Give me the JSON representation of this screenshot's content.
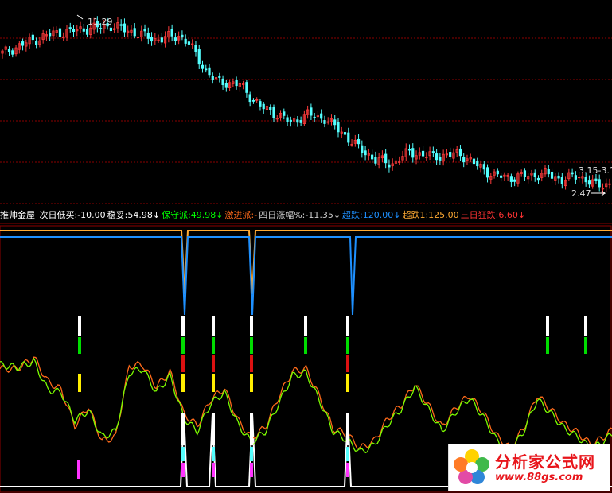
{
  "colors": {
    "bg": "#000000",
    "grid": "#8b0000",
    "up": "#ff3b3b",
    "down": "#54ffff",
    "orange_line": "#ff6a1a",
    "green_line": "#7cfc00",
    "lime_line": "#c8ff00",
    "gold": "#ffaa33",
    "blue": "#1e90ff",
    "magenta": "#ff33ff",
    "white": "#ffffff",
    "axis_text": "#dddddd"
  },
  "top_panel": {
    "annotations": {
      "high": "11.29",
      "right": "3.15-3.1",
      "low": "2.47"
    }
  },
  "info_bar": {
    "title": "推帅金屋",
    "items": [
      {
        "label": "次日低买:",
        "value": "-10.00",
        "color": "#ffffff"
      },
      {
        "label": "稳妥:",
        "value": "54.98",
        "color": "#ffffff",
        "arrow": "↓"
      },
      {
        "label": "保守派:",
        "value": "49.98",
        "color": "#00ff00",
        "arrow": "↓"
      },
      {
        "label": "激进派:",
        "value": "-",
        "color": "#ff6a1a"
      },
      {
        "label": "四日涨幅%:",
        "value": "-11.35",
        "color": "#cccccc",
        "arrow": "↓"
      },
      {
        "label": "超跌:",
        "value": "120.00",
        "color": "#1e90ff",
        "arrow": "↓"
      },
      {
        "label": "超跌1:",
        "value": "125.00",
        "color": "#ffaa33"
      },
      {
        "label": "三日狂跌:",
        "value": "6.60",
        "color": "#ff3333",
        "arrow": "↓"
      }
    ]
  },
  "watermark": {
    "title": "分析家公式网",
    "url": "www.88gs.com"
  },
  "chart_data": [
    {
      "type": "candlestick",
      "title": "",
      "n_bars": 180,
      "y_range": [
        2.0,
        12.0
      ],
      "high_marker": 11.29,
      "low_marker": 2.47,
      "close_path": [
        [
          0,
          9.7
        ],
        [
          8,
          10.3
        ],
        [
          15,
          10.7
        ],
        [
          23,
          10.9
        ],
        [
          28,
          11.0
        ],
        [
          32,
          11.1
        ],
        [
          40,
          10.7
        ],
        [
          45,
          10.4
        ],
        [
          52,
          10.6
        ],
        [
          55,
          10.2
        ],
        [
          60,
          8.8
        ],
        [
          63,
          8.3
        ],
        [
          70,
          8.1
        ],
        [
          76,
          7.0
        ],
        [
          80,
          6.7
        ],
        [
          85,
          6.2
        ],
        [
          90,
          6.6
        ],
        [
          95,
          6.4
        ],
        [
          100,
          5.7
        ],
        [
          105,
          4.9
        ],
        [
          110,
          4.3
        ],
        [
          115,
          4.1
        ],
        [
          120,
          4.7
        ],
        [
          125,
          4.5
        ],
        [
          130,
          4.5
        ],
        [
          135,
          4.6
        ],
        [
          140,
          4.0
        ],
        [
          145,
          3.5
        ],
        [
          150,
          3.4
        ],
        [
          155,
          3.5
        ],
        [
          160,
          3.6
        ],
        [
          165,
          3.3
        ],
        [
          170,
          3.5
        ],
        [
          175,
          3.0
        ],
        [
          180,
          3.1
        ]
      ]
    },
    {
      "type": "line",
      "title": "",
      "n_bars": 180,
      "y_range": [
        0,
        100
      ],
      "series": [
        {
          "color": "orange_line",
          "path": [
            [
              0,
              55
            ],
            [
              5,
              55
            ],
            [
              10,
              63
            ],
            [
              14,
              46
            ],
            [
              18,
              40
            ],
            [
              22,
              14
            ],
            [
              26,
              28
            ],
            [
              30,
              3
            ],
            [
              34,
              6
            ],
            [
              38,
              57
            ],
            [
              42,
              58
            ],
            [
              46,
              42
            ],
            [
              50,
              53
            ],
            [
              54,
              23
            ],
            [
              58,
              14
            ],
            [
              62,
              33
            ],
            [
              66,
              41
            ],
            [
              70,
              18
            ],
            [
              74,
              5
            ],
            [
              78,
              13
            ],
            [
              82,
              35
            ],
            [
              86,
              53
            ],
            [
              90,
              55
            ],
            [
              94,
              35
            ],
            [
              98,
              12
            ],
            [
              102,
              8
            ],
            [
              106,
              -2
            ],
            [
              110,
              3
            ],
            [
              114,
              19
            ],
            [
              118,
              29
            ],
            [
              122,
              44
            ],
            [
              126,
              29
            ],
            [
              130,
              13
            ],
            [
              134,
              27
            ],
            [
              138,
              36
            ],
            [
              142,
              24
            ],
            [
              146,
              7
            ],
            [
              150,
              -2
            ],
            [
              154,
              12
            ],
            [
              158,
              36
            ],
            [
              162,
              26
            ],
            [
              166,
              15
            ],
            [
              170,
              9
            ],
            [
              174,
              0
            ],
            [
              178,
              7
            ],
            [
              180,
              11
            ]
          ]
        },
        {
          "color": "green_line",
          "path": [
            [
              0,
              58
            ],
            [
              5,
              56
            ],
            [
              10,
              60
            ],
            [
              14,
              40
            ],
            [
              18,
              38
            ],
            [
              22,
              18
            ],
            [
              26,
              25
            ],
            [
              30,
              6
            ],
            [
              34,
              10
            ],
            [
              38,
              52
            ],
            [
              42,
              55
            ],
            [
              46,
              38
            ],
            [
              50,
              50
            ],
            [
              54,
              20
            ],
            [
              58,
              10
            ],
            [
              62,
              30
            ],
            [
              66,
              38
            ],
            [
              70,
              15
            ],
            [
              74,
              2
            ],
            [
              78,
              10
            ],
            [
              82,
              30
            ],
            [
              86,
              50
            ],
            [
              90,
              52
            ],
            [
              94,
              32
            ],
            [
              98,
              10
            ],
            [
              102,
              4
            ],
            [
              106,
              -5
            ],
            [
              110,
              0
            ],
            [
              114,
              15
            ],
            [
              118,
              26
            ],
            [
              122,
              42
            ],
            [
              126,
              26
            ],
            [
              130,
              10
            ],
            [
              134,
              24
            ],
            [
              138,
              34
            ],
            [
              142,
              21
            ],
            [
              146,
              4
            ],
            [
              150,
              -5
            ],
            [
              154,
              10
            ],
            [
              158,
              33
            ],
            [
              162,
              23
            ],
            [
              166,
              12
            ],
            [
              170,
              6
            ],
            [
              174,
              -3
            ],
            [
              178,
              4
            ],
            [
              180,
              8
            ]
          ]
        }
      ]
    }
  ]
}
